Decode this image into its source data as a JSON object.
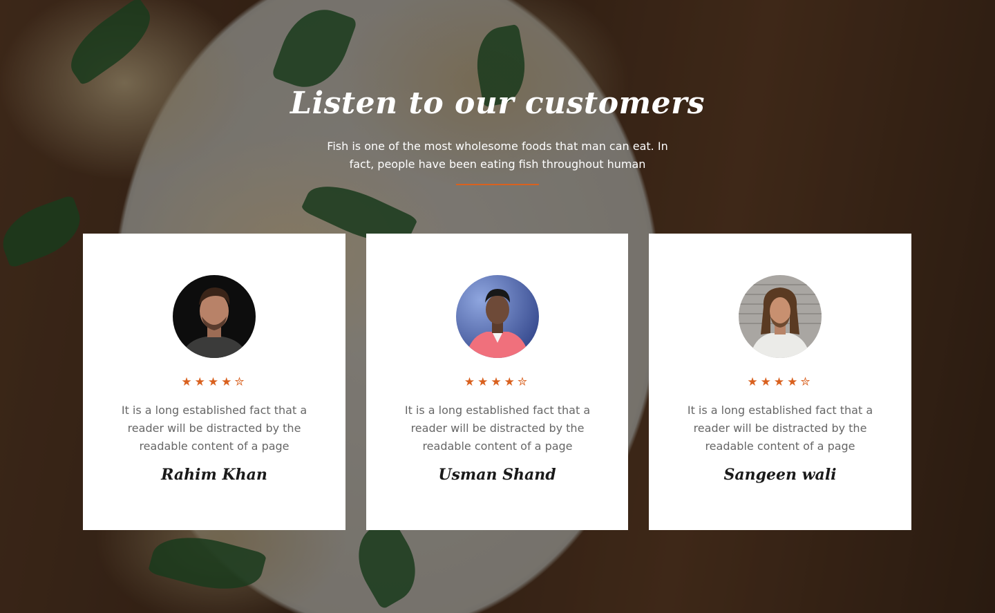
{
  "section": {
    "title": "Listen to our customers",
    "subtitle": "Fish is one of the most wholesome foods that man can eat. In fact, people have been eating fish throughout human",
    "accent_color": "#d9611f"
  },
  "testimonials": [
    {
      "name": "Rahim Khan",
      "quote": "It is a long established fact that a reader will be distracted by the readable content of a page",
      "rating": 4.5,
      "avatar_icon": "portrait-dark-background"
    },
    {
      "name": "Usman Shand",
      "quote": "It is a long established fact that a reader will be distracted by the readable content of a page",
      "rating": 4.5,
      "avatar_icon": "portrait-blue-background"
    },
    {
      "name": "Sangeen wali",
      "quote": "It is a long established fact that a reader will be distracted by the readable content of a page",
      "rating": 4.5,
      "avatar_icon": "portrait-grey-background"
    }
  ]
}
